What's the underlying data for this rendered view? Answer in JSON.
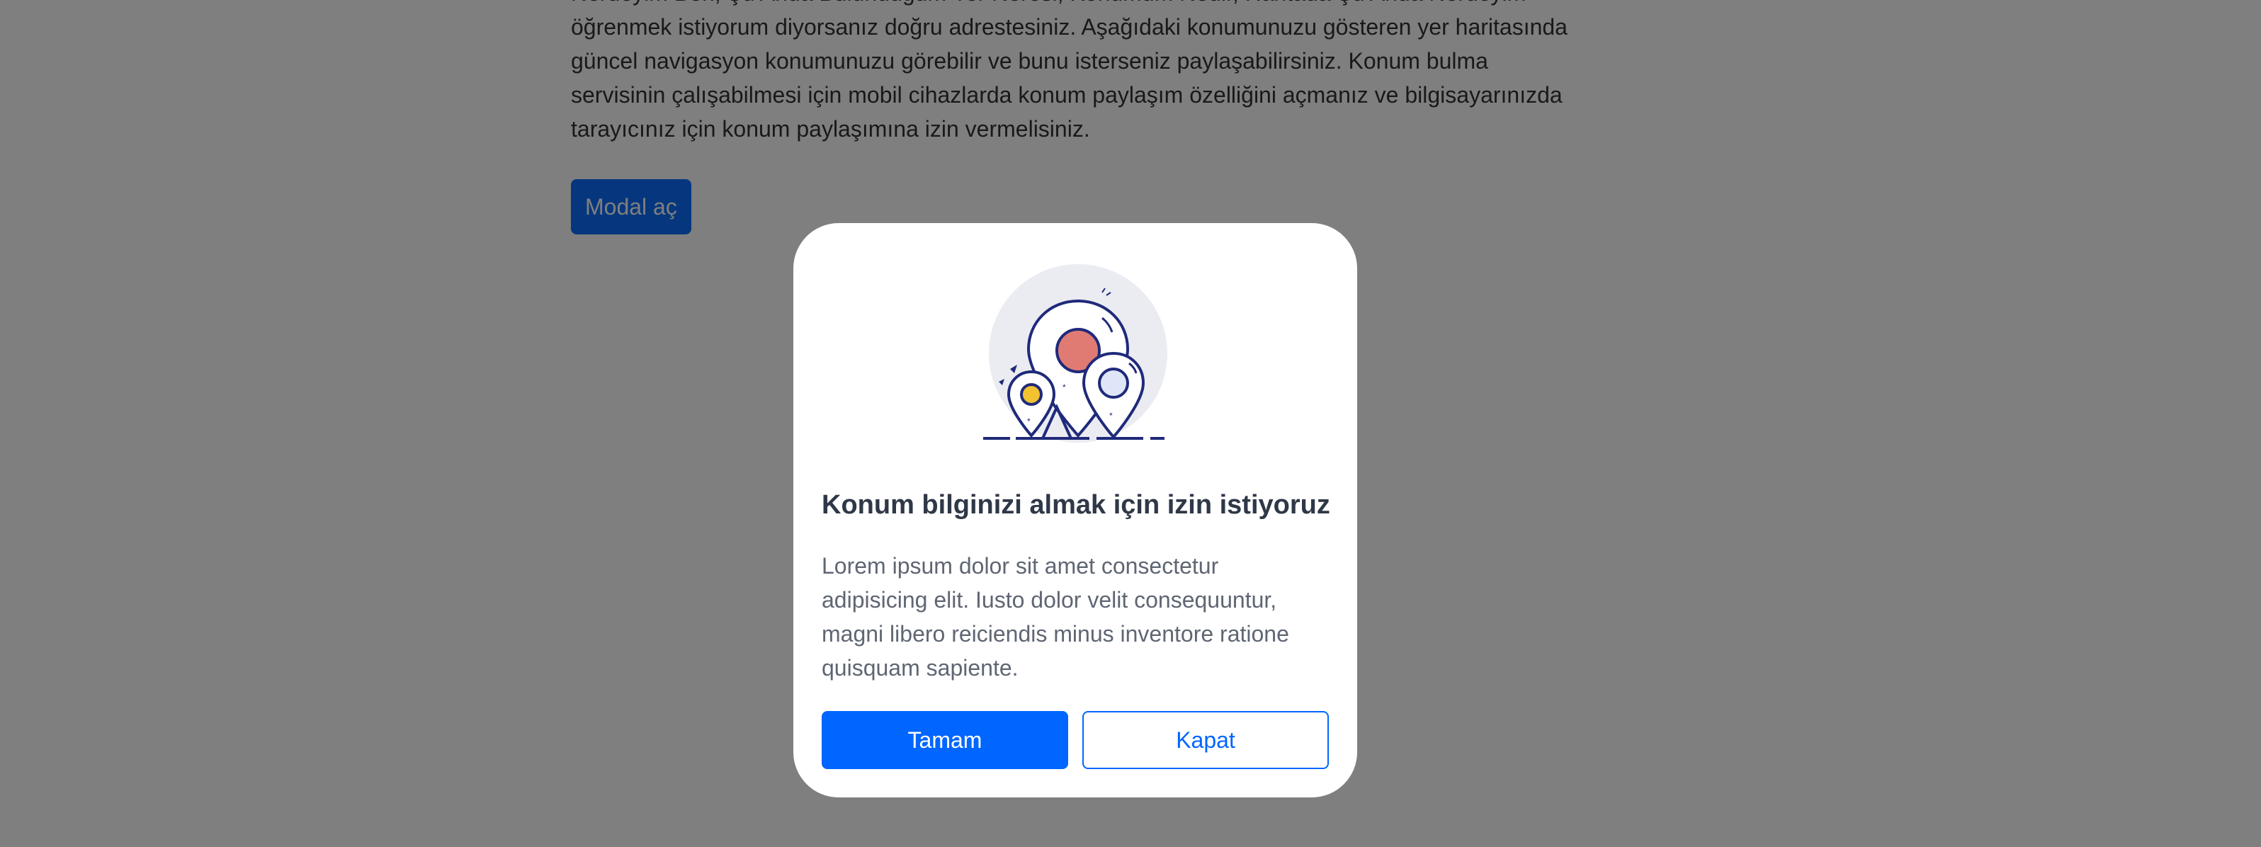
{
  "article": {
    "lines": [
      "Nerdeyim Ben, Şu Anda Bulunduğum Yer Neresi, Konumum Nedir, Haritada Şu Anda Nerdeyim",
      "öğrenmek istiyorum diyorsanız doğru adrestesiniz. Aşağıdaki konumunuzu gösteren yer haritasında",
      "güncel navigasyon konumunuzu görebilir ve bunu isterseniz paylaşabilirsiniz. Konum bulma",
      "servisinin çalışabilmesi için mobil cihazlarda konum paylaşım özelliğini açmanız ve bilgisayarınızda",
      "tarayıcınız için konum paylaşımına izin vermelisiniz."
    ],
    "open_modal_label": "Modal aç"
  },
  "modal": {
    "illustration_icon": "map-pins-icon",
    "title": "Konum bilginizi almak için izin istiyoruz",
    "body_lines": [
      "Lorem ipsum dolor sit amet consectetur",
      "adipisicing elit. Iusto dolor velit consequuntur,",
      "magni libero reiciendis minus inventore ratione",
      "quisquam sapiente."
    ],
    "ok_label": "Tamam",
    "close_label": "Kapat"
  },
  "colors": {
    "primary": "#0066ff",
    "backdrop": "rgba(0,0,0,0.5)",
    "pin_outline": "#1f2a7a",
    "pin_red": "#e07b73",
    "pin_yellow": "#f2c230",
    "pin_light": "#dfe6f7"
  }
}
